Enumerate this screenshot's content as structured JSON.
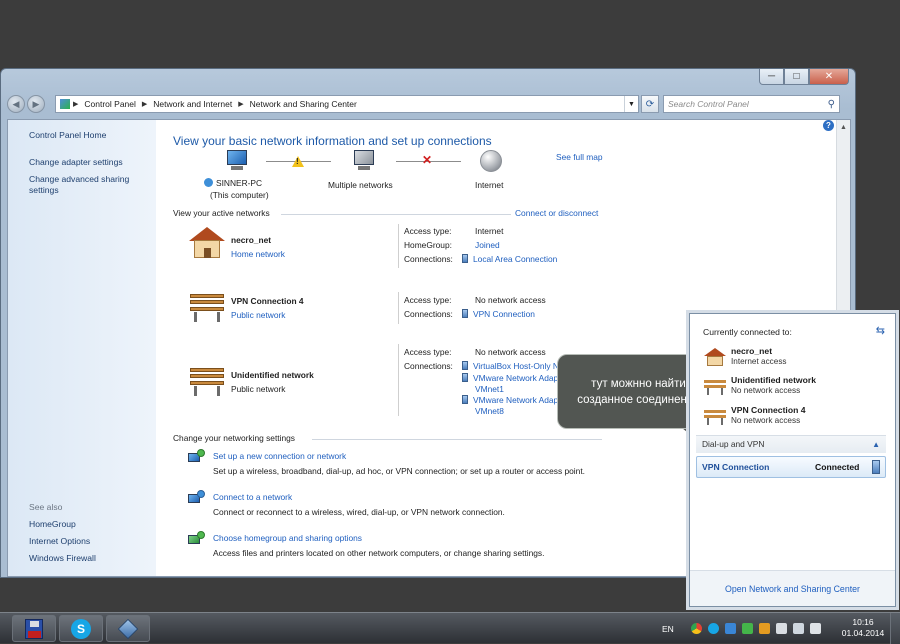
{
  "window": {
    "controls": {
      "minimize": "─",
      "maximize": "□",
      "close": "✕"
    },
    "breadcrumb": [
      "Control Panel",
      "Network and Internet",
      "Network and Sharing Center"
    ],
    "search_placeholder": "Search Control Panel"
  },
  "left_pane": {
    "items": [
      "Control Panel Home",
      "Change adapter settings",
      "Change advanced sharing settings"
    ],
    "see_also_label": "See also",
    "see_also": [
      "HomeGroup",
      "Internet Options",
      "Windows Firewall"
    ]
  },
  "main": {
    "title": "View your basic network information and set up connections",
    "see_full_map": "See full map",
    "map": {
      "computer_name": "SINNER-PC",
      "computer_sub": "(This computer)",
      "middle": "Multiple networks",
      "internet": "Internet"
    },
    "active_networks_header": "View your active networks",
    "connect_disconnect": "Connect or disconnect",
    "labels": {
      "access_type": "Access type:",
      "homegroup": "HomeGroup:",
      "connections": "Connections:"
    },
    "networks": [
      {
        "name": "necro_net",
        "category": "Home network",
        "access": "Internet",
        "homegroup": "Joined",
        "connections": [
          "Local Area Connection"
        ]
      },
      {
        "name": "VPN Connection  4",
        "category": "Public network",
        "access": "No network access",
        "connections": [
          "VPN Connection"
        ]
      },
      {
        "name": "Unidentified network",
        "category": "Public network",
        "access": "No network access",
        "connections": [
          "VirtualBox Host-Only Network",
          "VMware Network Adapter",
          "VMnet1",
          "VMware Network Adapter",
          "VMnet8"
        ]
      }
    ],
    "settings_header": "Change your networking settings",
    "settings": [
      {
        "title": "Set up a new connection or network",
        "desc": "Set up a wireless, broadband, dial-up, ad hoc, or VPN connection; or set up a router or access point."
      },
      {
        "title": "Connect to a network",
        "desc": "Connect or reconnect to a wireless, wired, dial-up, or VPN network connection."
      },
      {
        "title": "Choose homegroup and sharing options",
        "desc": "Access files and printers located on other network computers, or change sharing settings."
      }
    ]
  },
  "callout": {
    "line1": "тут можнно найти",
    "line2": "созданное соединение"
  },
  "flyout": {
    "header": "Currently connected to:",
    "networks": [
      {
        "name": "necro_net",
        "status": "Internet access"
      },
      {
        "name": "Unidentified network",
        "status": "No network access"
      },
      {
        "name": "VPN Connection  4",
        "status": "No network access"
      }
    ],
    "section": "Dial-up and VPN",
    "vpn": {
      "name": "VPN Connection",
      "status": "Connected"
    },
    "footer": "Open Network and Sharing Center"
  },
  "taskbar": {
    "lang": "EN",
    "time": "10:16",
    "date": "01.04.2014",
    "apps": [
      "save-disk-app",
      "skype-app",
      "virtualbox-app"
    ]
  },
  "colors": {
    "link": "#1f5fbf",
    "title": "#1e5aa8",
    "callout_bg": "#525652"
  }
}
